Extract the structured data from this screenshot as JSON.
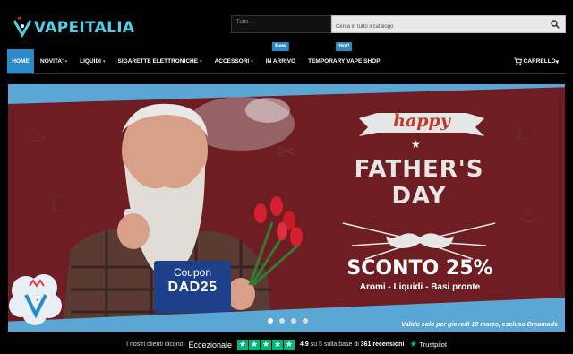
{
  "brand": {
    "name": "VAPEITALIA",
    "accent": "#4fd0e8",
    "nav_active": "#2a8bc8"
  },
  "search": {
    "scope": "Tutto",
    "placeholder": "Cerca in tutto il catalogo"
  },
  "nav": {
    "items": [
      {
        "label": "HOME",
        "active": true
      },
      {
        "label": "NOVITA'"
      },
      {
        "label": "LIQUIDI"
      },
      {
        "label": "SIGARETTE ELETTRONICHE"
      },
      {
        "label": "ACCESSORI"
      },
      {
        "label": "IN ARRIVO",
        "badge": "New"
      },
      {
        "label": "TEMPORARY VAPE SHOP",
        "badge": "Hot!"
      }
    ],
    "cart": "CARRELLO"
  },
  "banner": {
    "happy": "happy",
    "fathers": "FATHER'S",
    "day": "DAY",
    "discount": "SCONTO 25%",
    "subtitle": "Aromi - Liquidi - Basi pronte",
    "coupon_label": "Coupon",
    "coupon_code": "DAD25",
    "validity": "Valido solo per giovedì 19 marzo, escluso Dreamods",
    "slides": 4,
    "active_slide": 1
  },
  "trustpilot": {
    "intro": "I nostri clienti dicono",
    "rating_word": "Eccezionale",
    "stars": 5,
    "score": "4.9",
    "scale": "su 5 sulla base di",
    "count": "361 recensioni",
    "brand": "Trustpilot"
  }
}
